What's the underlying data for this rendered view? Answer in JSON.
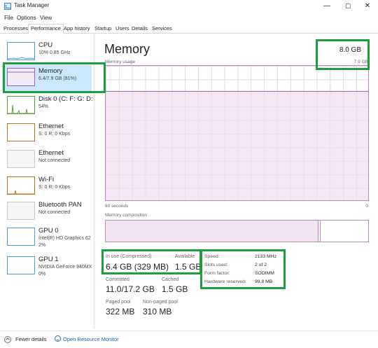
{
  "window": {
    "title": "Task Manager",
    "min_glyph": "—",
    "max_glyph": "☐",
    "close_glyph": "✕"
  },
  "menu": [
    "File",
    "Options",
    "View"
  ],
  "tabs": [
    "Processes",
    "Performance",
    "App history",
    "Startup",
    "Users",
    "Details",
    "Services"
  ],
  "active_tab": "Performance",
  "sidebar": [
    {
      "name": "CPU",
      "sub": "10% 0.85 GHz"
    },
    {
      "name": "Memory",
      "sub": "6.4/7.9 GB (81%)"
    },
    {
      "name": "Disk 0 (C: F: G: D:)",
      "sub": "54%"
    },
    {
      "name": "Ethernet",
      "sub": "S: 0 R: 0 Kbps"
    },
    {
      "name": "Ethernet",
      "sub": "Not connected"
    },
    {
      "name": "Wi-Fi",
      "sub": "S: 0 R: 0 Kbps"
    },
    {
      "name": "Bluetooth PAN",
      "sub": "Not connected"
    },
    {
      "name": "GPU 0",
      "sub": "Intel(R) HD Graphics 62",
      "sub2": "2%"
    },
    {
      "name": "GPU 1",
      "sub": "NVIDIA GeForce 940MX",
      "sub2": "0%"
    }
  ],
  "main": {
    "title": "Memory",
    "total": "8.0 GB",
    "usage_label": "Memory usage",
    "usage_max": "7.9 GB",
    "axis_left": "60 seconds",
    "axis_right": "0",
    "composition_label": "Memory composition",
    "usage_fraction": 0.81
  },
  "stats": {
    "in_use_label": "In use (Compressed)",
    "in_use_value": "6.4 GB (329 MB)",
    "available_label": "Available",
    "available_value": "1.5 GB",
    "committed_label": "Committed",
    "committed_value": "11.0/17.2 GB",
    "cached_label": "Cached",
    "cached_value": "1.5 GB",
    "paged_label": "Paged pool",
    "paged_value": "322 MB",
    "nonpaged_label": "Non-paged pool",
    "nonpaged_value": "310 MB"
  },
  "props": {
    "speed_label": "Speed:",
    "speed_value": "2133 MHz",
    "slots_label": "Slots used:",
    "slots_value": "2 of 2",
    "form_label": "Form factor:",
    "form_value": "SODIMM",
    "reserved_label": "Hardware reserved:",
    "reserved_value": "99.8 MB"
  },
  "footer": {
    "fewer": "Fewer details",
    "resmon": "Open Resource Monitor"
  },
  "colors": {
    "highlight": "#1e9e3e",
    "memory_accent": "#a55db0",
    "selected_bg": "#cce8ff",
    "link": "#1a5fb4"
  }
}
